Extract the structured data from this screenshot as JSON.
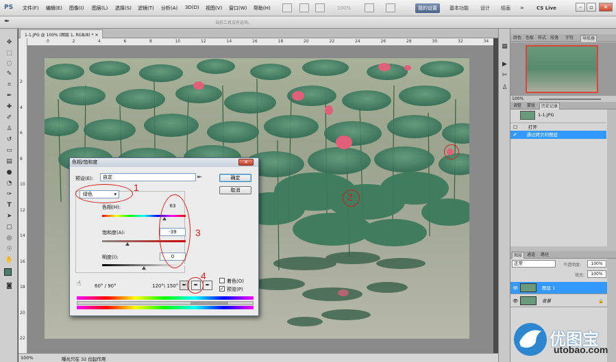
{
  "app": {
    "logo": "PS",
    "hint": "当前工具没有选项。",
    "ws_active": "我的设置",
    "ws_basic": "基本功能",
    "ws_design": "设计",
    "ws_paint": "绘画",
    "cslive": "CS Live",
    "zoom": "100%"
  },
  "menus": [
    "文件(F)",
    "编辑(E)",
    "图像(I)",
    "图层(L)",
    "选择(S)",
    "滤镜(T)",
    "分析(A)",
    "3D(D)",
    "视图(V)",
    "窗口(W)",
    "帮助(H)"
  ],
  "document": {
    "tab": "1-1.JPG @ 100% (图层 1, RGB/8) *",
    "status_zoom": "100%",
    "status_info": "曝光只在 32 位起作用"
  },
  "ruler_h": [
    "0",
    "2",
    "4",
    "6",
    "8",
    "10",
    "12",
    "14",
    "16",
    "18",
    "20",
    "22",
    "24",
    "26",
    "28",
    "30",
    "32",
    "34",
    "36"
  ],
  "ruler_v": [
    "2",
    "4",
    "6",
    "8",
    "10",
    "12",
    "14",
    "16",
    "18",
    "20",
    "22"
  ],
  "navigator": {
    "tabs": [
      "颜色",
      "色板",
      "样式",
      "段落",
      "字符",
      "导航器"
    ],
    "zoom": "100%"
  },
  "history": {
    "tabs": [
      "调整",
      "蒙版",
      "历史记录"
    ],
    "snapshot": "1-1.JPG",
    "items": [
      "打开",
      "通过拷贝的图层"
    ]
  },
  "layers": {
    "tabs": [
      "图层",
      "通道",
      "路径"
    ],
    "blend": "正常",
    "opacity_label": "不透明度:",
    "opacity": "100%",
    "fill_label": "填充:",
    "fill": "100%",
    "items": [
      "图层 1",
      "背景"
    ]
  },
  "dialog": {
    "title": "色相/饱和度",
    "preset_label": "预设(E):",
    "preset_value": "自定",
    "channel": "绿色",
    "hue_label": "色相(H):",
    "hue_value": "63",
    "sat_label": "饱和度(A):",
    "sat_value": "-39",
    "light_label": "明度(I):",
    "light_value": "0",
    "range_left": "60° / 90°",
    "range_right": "120°\\ 150°",
    "ok": "确定",
    "cancel": "取消",
    "colorize": "着色(O)",
    "preview": "预览(P)"
  },
  "annotations": [
    "1",
    "2",
    "3",
    "4"
  ],
  "watermark": {
    "text": "优图宝",
    "url": "utobao.com"
  },
  "colors": {
    "annotation": "#d21d1d",
    "selection": "#3399ff",
    "accent": "#4c6588"
  }
}
